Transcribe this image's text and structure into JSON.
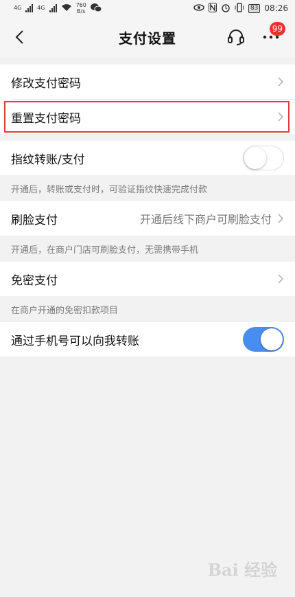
{
  "status_bar": {
    "net1": "4G",
    "net2": "4G",
    "speed_value": "760",
    "speed_unit": "B/s",
    "battery": "83",
    "time": "08:26"
  },
  "nav": {
    "title": "支付设置",
    "badge": "99"
  },
  "rows": {
    "modify_password": "修改支付密码",
    "reset_password": "重置支付密码",
    "fingerprint": "指纹转账/支付",
    "fingerprint_hint": "开通后，转账或支付时，可验证指纹快速完成付款",
    "face_pay": "刷脸支付",
    "face_pay_value": "开通后线下商户可刷脸支付",
    "face_pay_hint": "开通后，在商户门店可刷脸支付，无需携带手机",
    "password_free": "免密支付",
    "password_free_hint": "在商户开通的免密扣款项目",
    "phone_transfer": "通过手机号可以向我转账"
  },
  "toggles": {
    "fingerprint_on": false,
    "phone_transfer_on": true
  },
  "colors": {
    "accent": "#4a8df0",
    "highlight": "#e33b3b",
    "badge": "#e8332f"
  },
  "watermark": "Bai 经验"
}
